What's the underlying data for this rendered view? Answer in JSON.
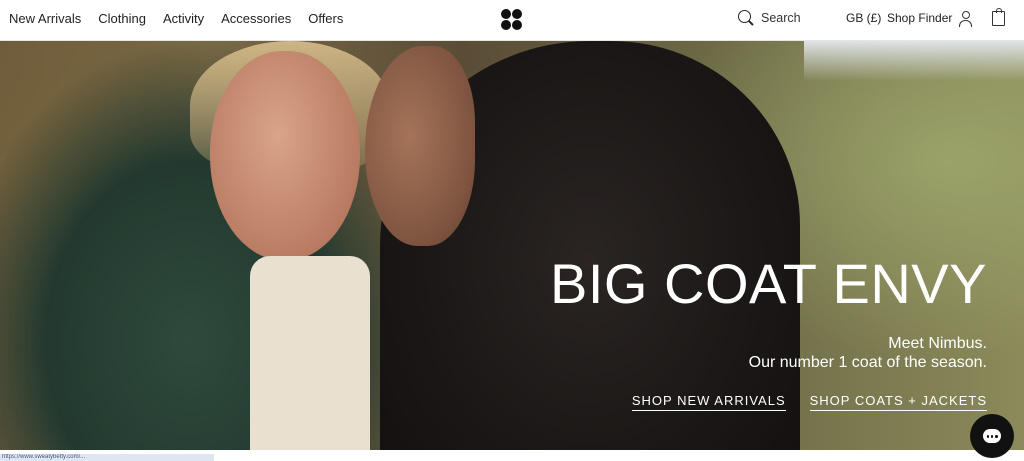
{
  "header": {
    "nav": [
      {
        "label": "New Arrivals"
      },
      {
        "label": "Clothing"
      },
      {
        "label": "Activity"
      },
      {
        "label": "Accessories"
      },
      {
        "label": "Offers"
      }
    ],
    "search_label": "Search",
    "locale": "GB (£)",
    "shop_finder": "Shop Finder"
  },
  "hero": {
    "title": "BIG COAT ENVY",
    "subtitle_line1": "Meet Nimbus.",
    "subtitle_line2": "Our number 1 coat of the season.",
    "cta_primary": "SHOP NEW ARRIVALS",
    "cta_secondary": "SHOP COATS + JACKETS"
  },
  "status_bar": {
    "text": "https://www.sweatybetty.com/..."
  },
  "colors": {
    "accent": "#111111",
    "hero_text": "#ffffff"
  }
}
